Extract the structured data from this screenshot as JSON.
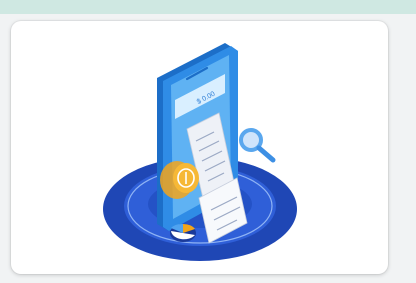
{
  "card": {
    "illustration": {
      "subject": "mobile-payment-receipt",
      "phone_screen_text": "$ 0.00",
      "icons": [
        "phone-icon",
        "receipt-icon",
        "coin-icon",
        "magnifier-icon",
        "pie-chart-icon",
        "pedestal"
      ],
      "colors": {
        "pedestal_dark": "#1f47b5",
        "pedestal_mid": "#2f5fd8",
        "phone_frame": "#2f8ce6",
        "phone_screen": "#5fb2f3",
        "receipt": "#eef1f7",
        "coin": "#f3a51a",
        "magnifier": "#5aa7ee"
      }
    }
  }
}
